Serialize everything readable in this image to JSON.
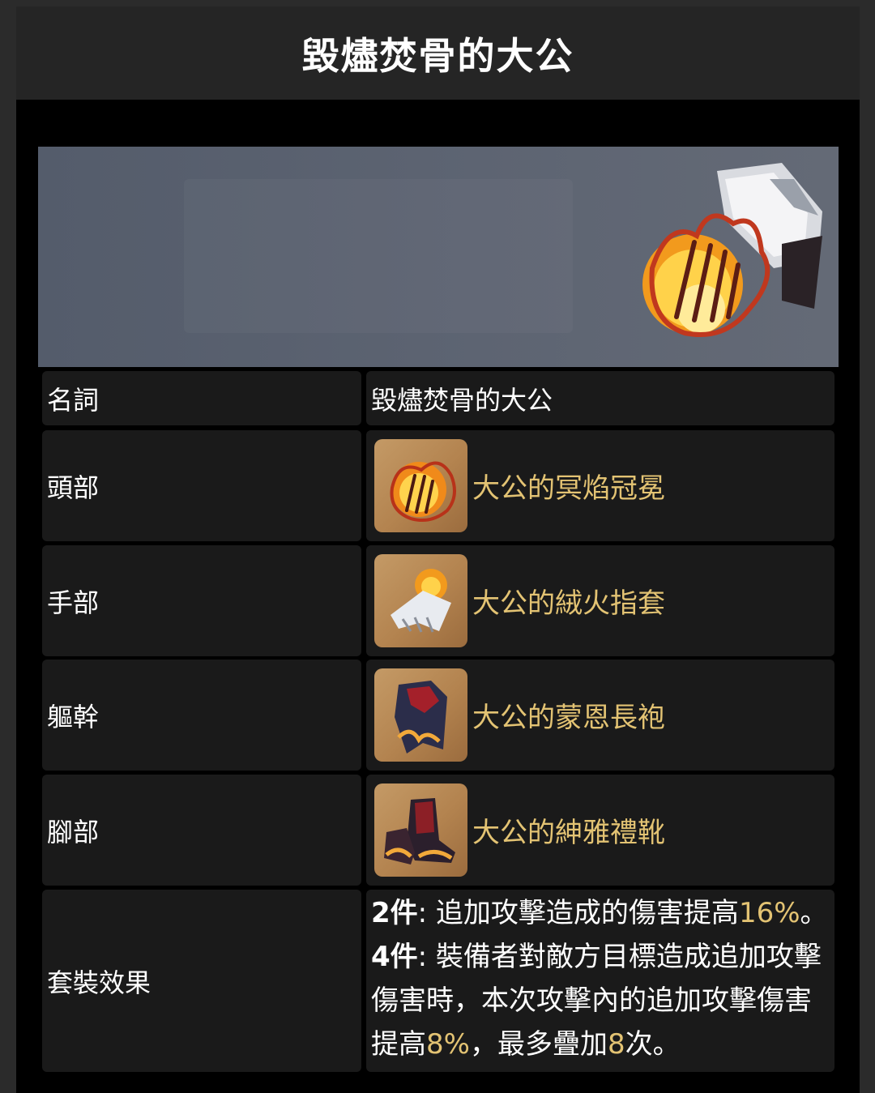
{
  "title": "毀燼焚骨的大公",
  "table": {
    "name_row": {
      "key": "名詞",
      "value": "毀燼焚骨的大公"
    },
    "pieces": [
      {
        "key": "頭部",
        "item": "大公的冥焰冠冕",
        "icon": "crown-flame-icon"
      },
      {
        "key": "手部",
        "item": "大公的絨火指套",
        "icon": "gloves-flame-icon"
      },
      {
        "key": "軀幹",
        "item": "大公的蒙恩長袍",
        "icon": "robe-icon"
      },
      {
        "key": "腳部",
        "item": "大公的紳雅禮靴",
        "icon": "boots-icon"
      }
    ],
    "set_effect": {
      "key": "套裝效果",
      "two_label": "2件",
      "two_text_a": ": 追加攻擊造成的傷害提高",
      "two_value": "16%",
      "two_text_b": "。",
      "four_label": "4件",
      "four_text_a": ": 裝備者對敵方目標造成追加攻擊傷害時，本次攻擊內的追加攻擊傷害提高",
      "four_value_a": "8%",
      "four_text_b": "，最多疊加",
      "four_value_b": "8",
      "four_text_c": "次。"
    }
  },
  "colors": {
    "highlight": "#e3c373",
    "cell": "#1a1a1a",
    "header": "#252525"
  }
}
